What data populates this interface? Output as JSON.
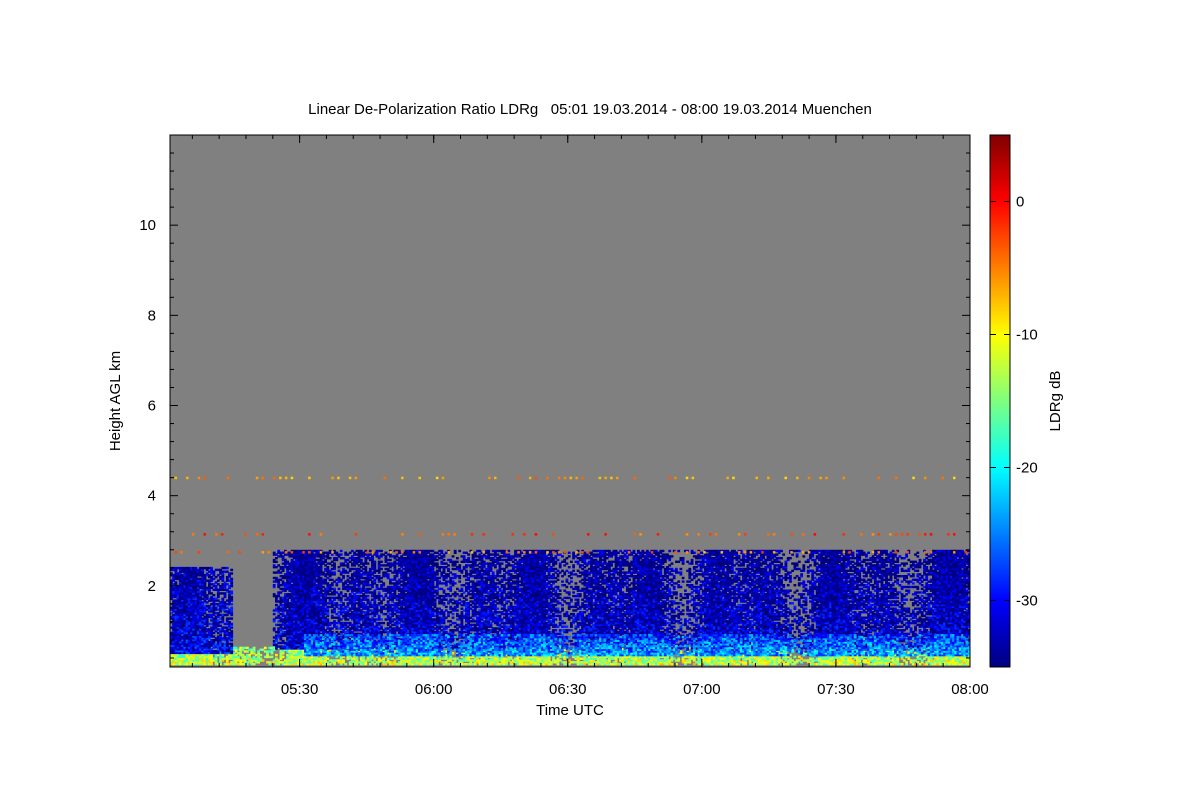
{
  "chart_data": {
    "type": "heatmap",
    "title": "Linear De-Polarization Ratio LDRg   05:01 19.03.2014 - 08:00 19.03.2014 Muenchen",
    "xlabel": "Time UTC",
    "ylabel": "Height AGL km",
    "colorbar_label": "LDRg dB",
    "x_range_utc": [
      "05:01",
      "08:00"
    ],
    "x_range_minutes": [
      0,
      179
    ],
    "x_ticks": [
      {
        "minute": 29,
        "label": "05:30"
      },
      {
        "minute": 59,
        "label": "06:00"
      },
      {
        "minute": 89,
        "label": "06:30"
      },
      {
        "minute": 119,
        "label": "07:00"
      },
      {
        "minute": 149,
        "label": "07:30"
      },
      {
        "minute": 179,
        "label": "08:00"
      }
    ],
    "y_range_km": [
      0.2,
      12.0
    ],
    "y_ticks": [
      {
        "value": 2,
        "label": "2"
      },
      {
        "value": 4,
        "label": "4"
      },
      {
        "value": 6,
        "label": "6"
      },
      {
        "value": 8,
        "label": "8"
      },
      {
        "value": 10,
        "label": "10"
      }
    ],
    "colorbar_range_db": [
      -35,
      5
    ],
    "colorbar_ticks": [
      {
        "value": 0,
        "label": "0"
      },
      {
        "value": -10,
        "label": "-10"
      },
      {
        "value": -20,
        "label": "-20"
      },
      {
        "value": -30,
        "label": "-30"
      }
    ],
    "colormap": [
      "#00007f",
      "#0000ff",
      "#007fff",
      "#00ffff",
      "#7fff7f",
      "#ffff00",
      "#ff7f00",
      "#ff0000",
      "#7f0000"
    ],
    "no_data_color": "#808080",
    "regions": [
      {
        "name": "near-surface layer",
        "t_start": 0,
        "t_end": 179,
        "h_bottom": 0.25,
        "h_top": 0.65,
        "ldr_db": -12
      },
      {
        "name": "early low cloud",
        "t_start": 0,
        "t_end": 14,
        "h_bottom": 0.5,
        "h_top": 2.4,
        "ldr_db": -31
      },
      {
        "name": "main cloud layer",
        "t_start": 23,
        "t_end": 179,
        "h_bottom": 0.6,
        "h_top": 2.8,
        "ldr_db": -32
      },
      {
        "name": "cloud base streak",
        "t_start": 30,
        "t_end": 179,
        "h_bottom": 0.45,
        "h_top": 0.9,
        "ldr_db": -24
      }
    ],
    "elevated_points": [
      {
        "name": "layer near 4.4 km",
        "height_km": 4.4,
        "ldr_db": -6
      },
      {
        "name": "layer near 3.15 km",
        "height_km": 3.15,
        "ldr_db": -3
      },
      {
        "name": "layer near 2.75 km",
        "height_km": 2.75,
        "ldr_db": -5
      }
    ]
  }
}
